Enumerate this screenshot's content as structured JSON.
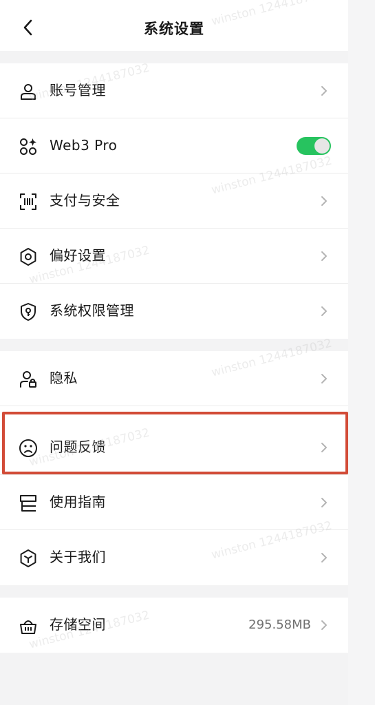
{
  "header": {
    "title": "系统设置"
  },
  "groups": [
    {
      "items": [
        {
          "label": "账号管理",
          "icon": "user-icon",
          "type": "chevron"
        },
        {
          "label": "Web3 Pro",
          "icon": "apps-sparkle-icon",
          "type": "toggle",
          "on": true
        },
        {
          "label": "支付与安全",
          "icon": "scan-icon",
          "type": "chevron"
        },
        {
          "label": "偏好设置",
          "icon": "gear-icon",
          "type": "chevron"
        },
        {
          "label": "系统权限管理",
          "icon": "shield-key-icon",
          "type": "chevron"
        }
      ]
    },
    {
      "items": [
        {
          "label": "隐私",
          "icon": "user-lock-icon",
          "type": "chevron"
        },
        {
          "label": "问题反馈",
          "icon": "frown-face-icon",
          "type": "chevron",
          "highlighted": true
        },
        {
          "label": "使用指南",
          "icon": "guide-book-icon",
          "type": "chevron"
        },
        {
          "label": "关于我们",
          "icon": "hexagon-cube-icon",
          "type": "chevron"
        }
      ]
    },
    {
      "items": [
        {
          "label": "存储空间",
          "icon": "basket-icon",
          "type": "chevron",
          "value": "295.58MB"
        }
      ]
    }
  ],
  "watermark": "winston 1244187032",
  "colors": {
    "toggle_on": "#27c35f",
    "highlight": "#d24b37"
  }
}
